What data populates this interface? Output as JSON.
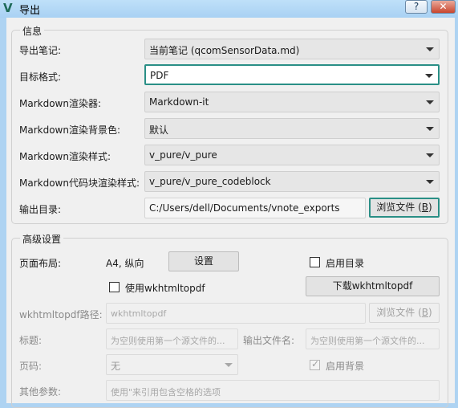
{
  "window": {
    "app_icon": "V",
    "title": "导出",
    "help_label": "?",
    "close_label": "✕"
  },
  "info_group": {
    "legend": "信息",
    "rows": [
      {
        "label": "导出笔记:",
        "value": "当前笔记 (qcomSensorData.md)"
      },
      {
        "label": "目标格式:",
        "value": "PDF"
      },
      {
        "label": "Markdown渲染器:",
        "value": "Markdown-it"
      },
      {
        "label": "Markdown渲染背景色:",
        "value": "默认"
      },
      {
        "label": "Markdown渲染样式:",
        "value": "v_pure/v_pure"
      },
      {
        "label": "Markdown代码块渲染样式:",
        "value": "v_pure/v_pure_codeblock"
      }
    ],
    "output_dir": {
      "label": "输出目录:",
      "value": "C:/Users/dell/Documents/vnote_exports",
      "browse_text": "浏览文件 (",
      "browse_key": "B",
      "browse_close": ")"
    }
  },
  "advanced_group": {
    "legend": "高级设置",
    "page_layout_label": "页面布局:",
    "page_layout_value": "A4, 纵向",
    "settings_button": "设置",
    "enable_toc_label": "启用目录",
    "use_wkhtmltopdf_label": "使用wkhtmltopdf",
    "download_button": "下载wkhtmltopdf",
    "wk_path_label": "wkhtmltopdf路径:",
    "wk_path_value": "wkhtmltopdf",
    "browse_text": "浏览文件 (",
    "browse_key": "B",
    "browse_close": ")",
    "title_label": "标题:",
    "title_placeholder": "为空则使用第一个源文件的...",
    "output_name_label": "输出文件名:",
    "output_name_placeholder": "为空则使用第一个源文件的...",
    "page_number_label": "页码:",
    "page_number_value": "无",
    "enable_bg_label": "启用背景",
    "other_args_label": "其他参数:",
    "other_args_placeholder": "使用\"来引用包含空格的选项"
  }
}
